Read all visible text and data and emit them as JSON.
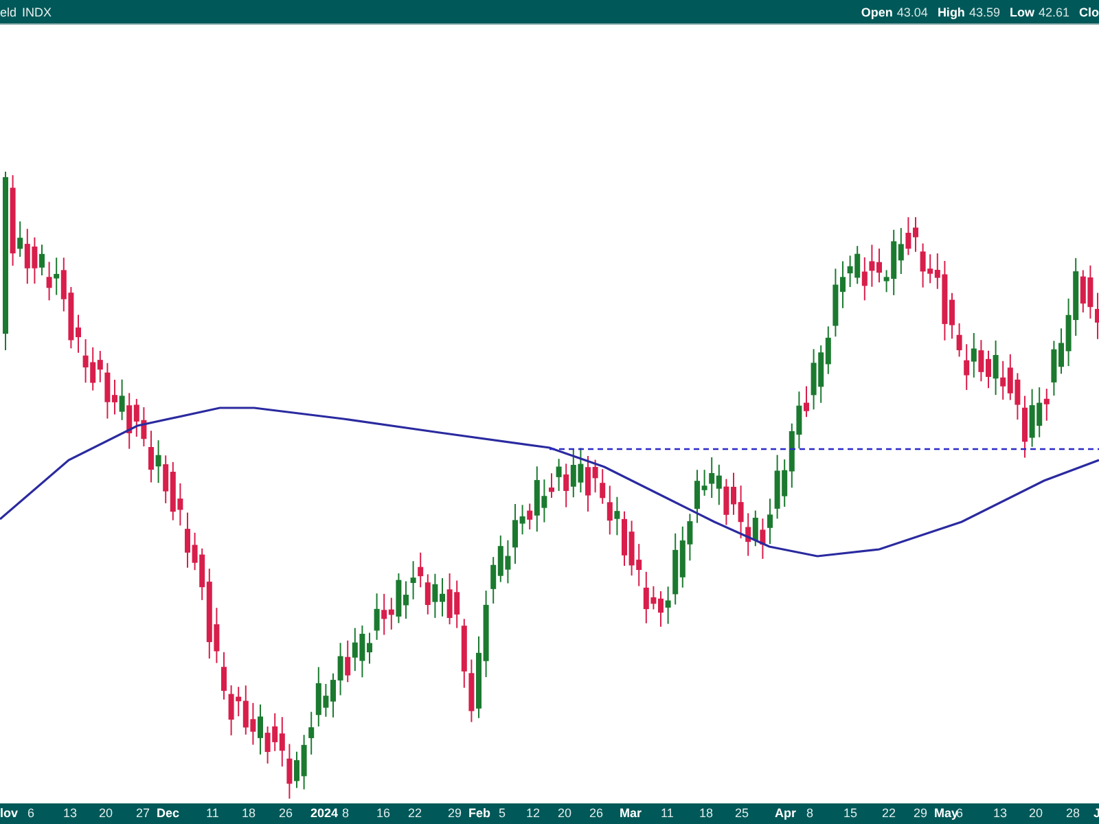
{
  "header": {
    "title": "eld",
    "symbol": "INDX",
    "stats": [
      {
        "label": "Open",
        "value": "43.04"
      },
      {
        "label": "High",
        "value": "43.59"
      },
      {
        "label": "Low",
        "value": "42.61"
      },
      {
        "label": "Clo"
      }
    ]
  },
  "x_axis": {
    "labels": [
      {
        "text": "lov",
        "kind": "month"
      },
      {
        "text": "6",
        "kind": "day"
      },
      {
        "text": "13",
        "kind": "day"
      },
      {
        "text": "20",
        "kind": "day"
      },
      {
        "text": "27",
        "kind": "day"
      },
      {
        "text": "Dec",
        "kind": "month"
      },
      {
        "text": "11",
        "kind": "day"
      },
      {
        "text": "18",
        "kind": "day"
      },
      {
        "text": "26",
        "kind": "day"
      },
      {
        "text": "2024",
        "kind": "month"
      },
      {
        "text": "8",
        "kind": "day"
      },
      {
        "text": "16",
        "kind": "day"
      },
      {
        "text": "22",
        "kind": "day"
      },
      {
        "text": "29",
        "kind": "day"
      },
      {
        "text": "Feb",
        "kind": "month"
      },
      {
        "text": "5",
        "kind": "day"
      },
      {
        "text": "12",
        "kind": "day"
      },
      {
        "text": "20",
        "kind": "day"
      },
      {
        "text": "26",
        "kind": "day"
      },
      {
        "text": "Mar",
        "kind": "month"
      },
      {
        "text": "11",
        "kind": "day"
      },
      {
        "text": "18",
        "kind": "day"
      },
      {
        "text": "25",
        "kind": "day"
      },
      {
        "text": "Apr",
        "kind": "month"
      },
      {
        "text": "8",
        "kind": "day"
      },
      {
        "text": "15",
        "kind": "day"
      },
      {
        "text": "22",
        "kind": "day"
      },
      {
        "text": "29",
        "kind": "day"
      },
      {
        "text": "May",
        "kind": "month"
      },
      {
        "text": "6",
        "kind": "day"
      },
      {
        "text": "13",
        "kind": "day"
      },
      {
        "text": "20",
        "kind": "day"
      },
      {
        "text": "28",
        "kind": "day"
      },
      {
        "text": "J",
        "kind": "month"
      }
    ]
  }
}
